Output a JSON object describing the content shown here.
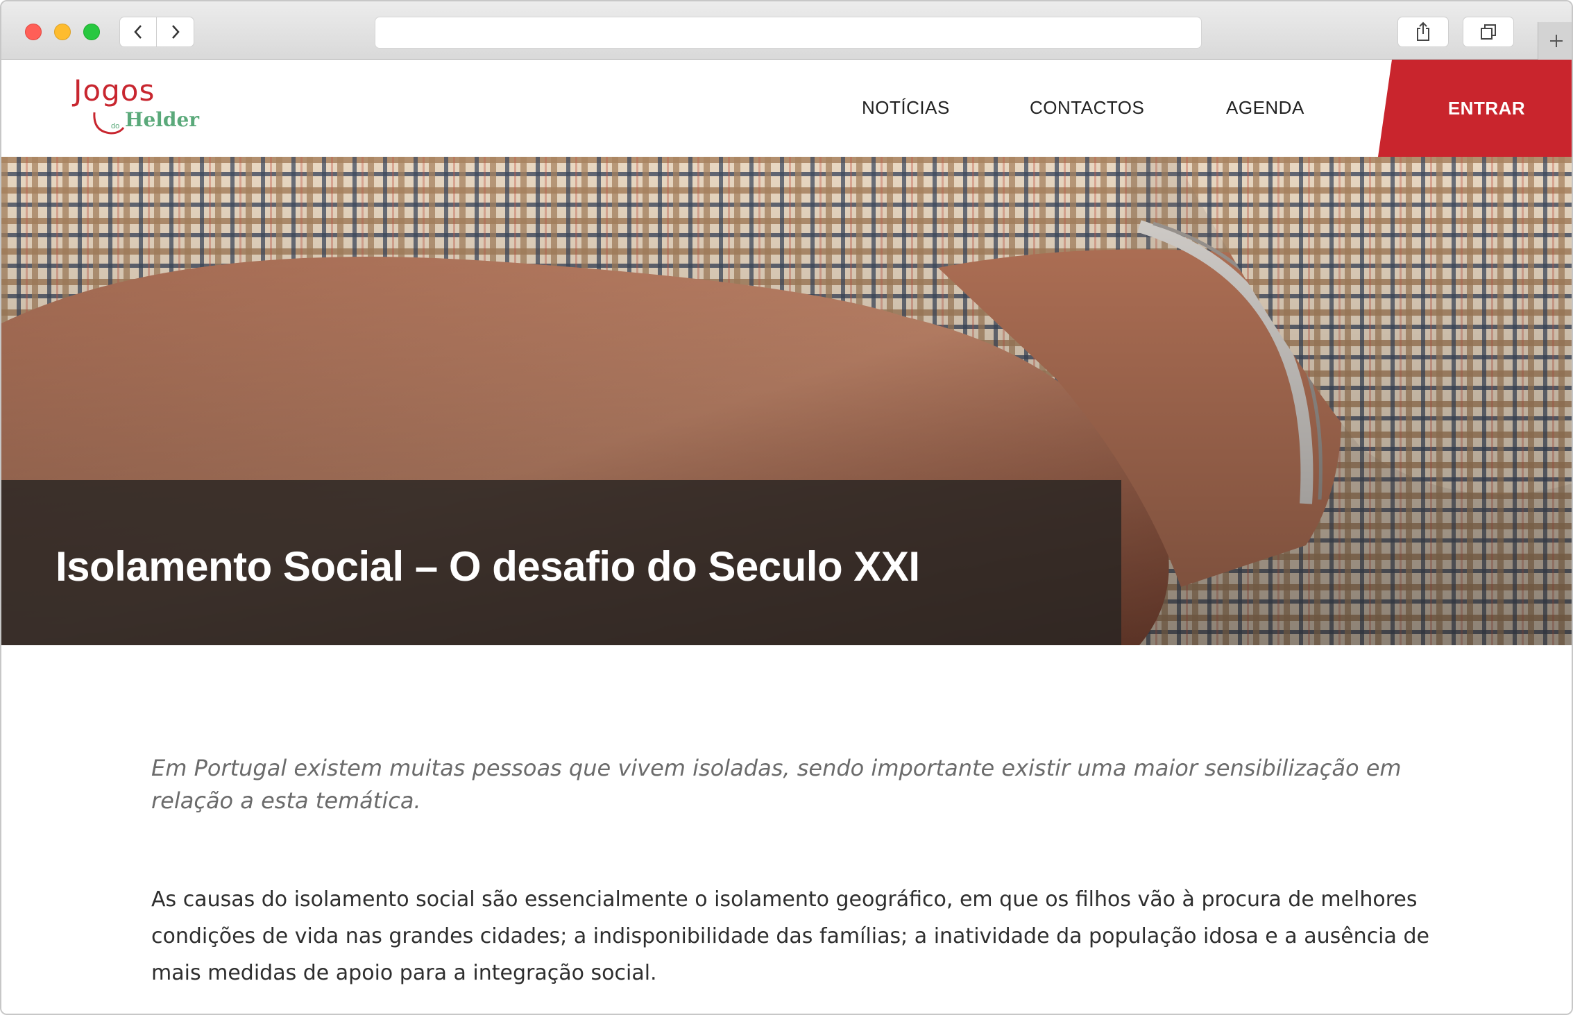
{
  "browser": {
    "address": "",
    "icons": {
      "back": "chevron-left-icon",
      "forward": "chevron-right-icon",
      "share": "share-icon",
      "tabs": "tabs-icon",
      "new_tab": "plus-icon"
    }
  },
  "site": {
    "logo": {
      "line1": "Jogos",
      "small": "do",
      "line2": "Helder"
    },
    "nav": {
      "noticias": "NOTÍCIAS",
      "contactos": "CONTACTOS",
      "agenda": "AGENDA",
      "entrar": "ENTRAR"
    },
    "colors": {
      "brand_red": "#c9252d",
      "brand_green": "#5aa97a"
    }
  },
  "hero": {
    "title": "Isolamento Social – O desafio do Seculo XXI"
  },
  "article": {
    "lead": "Em Portugal existem muitas pessoas que vivem isoladas, sendo importante existir uma maior sensibilização em relação a esta temática.",
    "body": "As causas do isolamento social são essencialmente o isolamento geográfico, em que os filhos vão à procura de melhores condições de vida nas grandes cidades; a indisponibilidade das famílias; a inatividade da população idosa e a ausência de mais medidas de apoio para a integração social."
  }
}
